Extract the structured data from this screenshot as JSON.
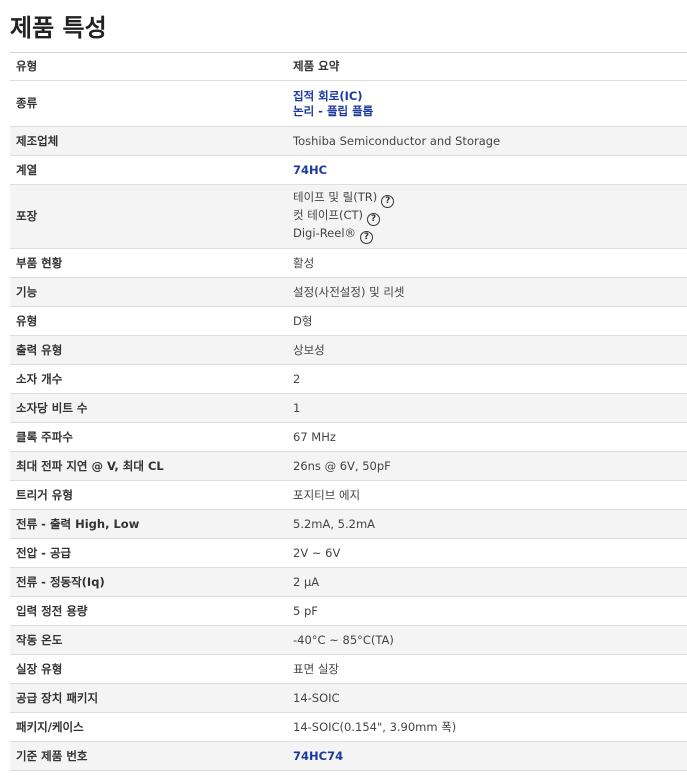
{
  "title": "제품 특성",
  "header": {
    "attr": "유형",
    "val": "제품 요약"
  },
  "rows": [
    {
      "attr": "종류",
      "values": [
        "집적 회로(IC)",
        "논리 - 플립 플롭"
      ],
      "link": true
    },
    {
      "attr": "제조업체",
      "values": [
        "Toshiba Semiconductor and Storage"
      ]
    },
    {
      "attr": "계열",
      "values": [
        "74HC"
      ],
      "link": true
    },
    {
      "attr": "포장",
      "values": [
        "테이프 및 릴(TR)",
        "컷 테이프(CT)",
        "Digi-Reel®"
      ],
      "help": true,
      "help_icon": "question-circle-icon"
    },
    {
      "attr": "부품 현황",
      "values": [
        "활성"
      ]
    },
    {
      "attr": "기능",
      "values": [
        "설정(사전설정) 및 리셋"
      ]
    },
    {
      "attr": "유형",
      "values": [
        "D형"
      ]
    },
    {
      "attr": "출력 유형",
      "values": [
        "상보성"
      ]
    },
    {
      "attr": "소자 개수",
      "values": [
        "2"
      ]
    },
    {
      "attr": "소자당 비트 수",
      "values": [
        "1"
      ]
    },
    {
      "attr": "클록 주파수",
      "values": [
        "67 MHz"
      ]
    },
    {
      "attr": "최대 전파 지연 @ V, 최대 CL",
      "values": [
        "26ns @ 6V, 50pF"
      ]
    },
    {
      "attr": "트리거 유형",
      "values": [
        "포지티브 에지"
      ]
    },
    {
      "attr": "전류 - 출력 High, Low",
      "values": [
        "5.2mA, 5.2mA"
      ]
    },
    {
      "attr": "전압 - 공급",
      "values": [
        "2V ~ 6V"
      ]
    },
    {
      "attr": "전류 - 정동작(Iq)",
      "values": [
        "2 µA"
      ]
    },
    {
      "attr": "입력 정전 용량",
      "values": [
        "5 pF"
      ]
    },
    {
      "attr": "작동 온도",
      "values": [
        "-40°C ~ 85°C(TA)"
      ]
    },
    {
      "attr": "실장 유형",
      "values": [
        "표면 실장"
      ]
    },
    {
      "attr": "공급 장치 패키지",
      "values": [
        "14-SOIC"
      ]
    },
    {
      "attr": "패키지/케이스",
      "values": [
        "14-SOIC(0.154\", 3.90mm 폭)"
      ]
    },
    {
      "attr": "기준 제품 번호",
      "values": [
        "74HC74"
      ],
      "link": true
    }
  ],
  "help_glyph": "?",
  "colors": {
    "link": "#1c3a9e",
    "alt_row": "#f4f4f4"
  }
}
